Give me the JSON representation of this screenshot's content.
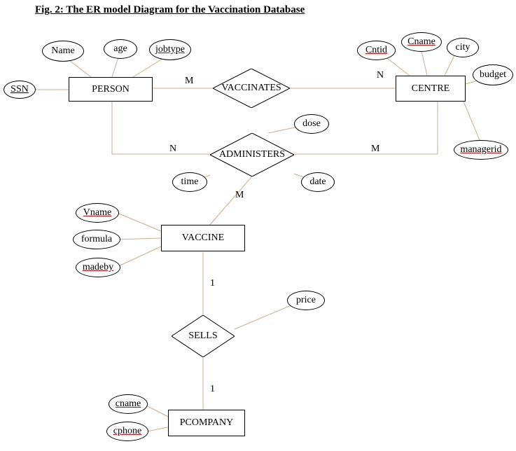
{
  "title": "Fig. 2: The ER model Diagram for the Vaccination Database",
  "entities": {
    "person": "PERSON",
    "centre": "CENTRE",
    "vaccine": "VACCINE",
    "pcompany": "PCOMPANY"
  },
  "relations": {
    "vaccinates": "VACCINATES",
    "administers": "ADMINISTERS",
    "sells": "SELLS"
  },
  "attributes": {
    "name": "Name",
    "age": "age",
    "jobtype": "jobtype",
    "ssn": "SSN",
    "cntid": "Cntid",
    "cname_centre": "Cname",
    "city": "city",
    "budget": "budget",
    "managerid": "managerid",
    "dose": "dose",
    "time": "time",
    "date": "date",
    "vname": "Vname",
    "formula": "formula",
    "madeby": "madeby",
    "price": "price",
    "cname_pc": "cname",
    "cphone": "cphone"
  },
  "cardinality": {
    "M": "M",
    "N": "N",
    "one": "1"
  },
  "chart_data": {
    "type": "er-diagram",
    "entities": [
      {
        "name": "PERSON",
        "attributes": [
          "SSN",
          "Name",
          "age",
          "jobtype"
        ],
        "key": "SSN"
      },
      {
        "name": "CENTRE",
        "attributes": [
          "Cntid",
          "Cname",
          "city",
          "budget",
          "managerid"
        ],
        "key": "Cntid"
      },
      {
        "name": "VACCINE",
        "attributes": [
          "Vname",
          "formula",
          "madeby"
        ],
        "key": "Vname"
      },
      {
        "name": "PCOMPANY",
        "attributes": [
          "cname",
          "cphone"
        ],
        "key": "cname"
      }
    ],
    "relationships": [
      {
        "name": "VACCINATES",
        "between": [
          "PERSON",
          "CENTRE"
        ],
        "cardinality": [
          "M",
          "N"
        ],
        "attributes": []
      },
      {
        "name": "ADMINISTERS",
        "between": [
          "PERSON",
          "CENTRE",
          "VACCINE"
        ],
        "cardinality": [
          "N",
          "M",
          "M"
        ],
        "attributes": [
          "dose",
          "time",
          "date"
        ]
      },
      {
        "name": "SELLS",
        "between": [
          "VACCINE",
          "PCOMPANY"
        ],
        "cardinality": [
          "1",
          "1"
        ],
        "attributes": [
          "price"
        ]
      }
    ]
  }
}
